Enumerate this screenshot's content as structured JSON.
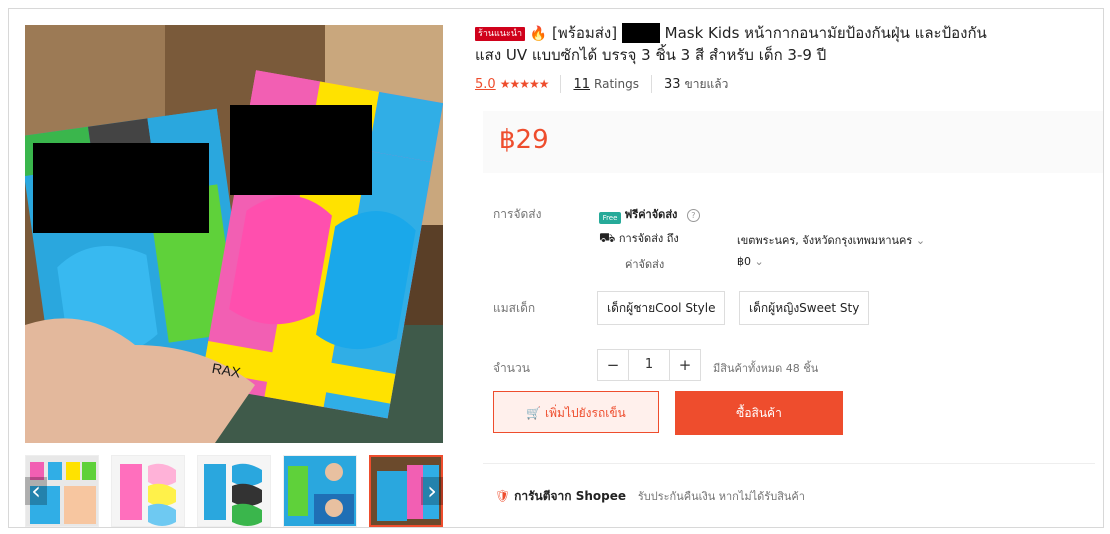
{
  "colors": {
    "accent": "#ee4d2d",
    "free_shipping": "#26aa99",
    "badge": "#d0011b"
  },
  "product": {
    "badge": "ร้านแนะนำ",
    "title_part1": "[พร้อมส่ง]",
    "title_part2": "Mask Kids หน้ากากอนามัยป้องกันฝุ่น และป้องกัน",
    "title_line2": "แสง UV แบบซักได้ บรรจุ 3 ชิ้น 3 สี สำหรับ เด็ก 3-9 ปี",
    "rating": "5.0",
    "stars": "★★★★★",
    "ratings_count": "11",
    "ratings_label": "Ratings",
    "sold": "33",
    "sold_label": "ขายแล้ว",
    "price": "฿29"
  },
  "shipping": {
    "label": "การจัดส่ง",
    "free_icon_text": "Free",
    "free_text": "ฟรีค่าจัดส่ง",
    "to_label": "การจัดส่ง ถึง",
    "to_value": "เขตพระนคร, จังหวัดกรุงเทพมหานคร",
    "fee_label": "ค่าจัดส่ง",
    "fee_value": "฿0"
  },
  "variant": {
    "label": "แมสเด็ก",
    "options": [
      "เด็กผู้ชายCool Style",
      "เด็กผู้หญิงSweet Sty"
    ]
  },
  "quantity": {
    "label": "จำนวน",
    "minus": "−",
    "value": "1",
    "plus": "+",
    "stock": "มีสินค้าทั้งหมด 48 ชิ้น"
  },
  "actions": {
    "add_to_cart": "เพิ่มไปยังรถเข็น",
    "buy_now": "ซื้อสินค้า"
  },
  "guarantee": {
    "title": "การันตีจาก Shopee",
    "text": "รับประกันคืนเงิน หากไม่ได้รับสินค้า"
  },
  "gallery": {
    "prev_icon": "‹",
    "next_icon": "›",
    "brand_text": "RAX"
  }
}
